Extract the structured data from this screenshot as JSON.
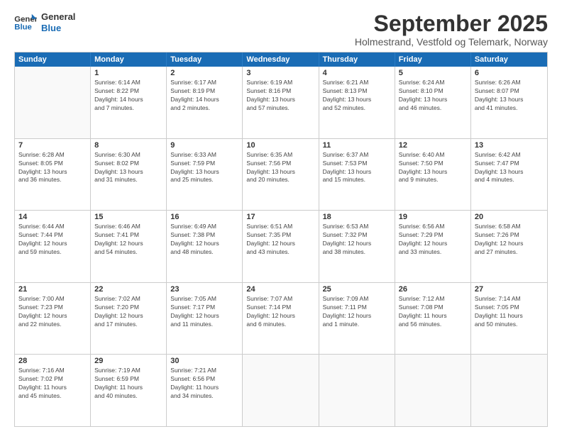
{
  "logo": {
    "line1": "General",
    "line2": "Blue"
  },
  "title": "September 2025",
  "location": "Holmestrand, Vestfold og Telemark, Norway",
  "header_days": [
    "Sunday",
    "Monday",
    "Tuesday",
    "Wednesday",
    "Thursday",
    "Friday",
    "Saturday"
  ],
  "weeks": [
    [
      {
        "day": "",
        "info": ""
      },
      {
        "day": "1",
        "info": "Sunrise: 6:14 AM\nSunset: 8:22 PM\nDaylight: 14 hours\nand 7 minutes."
      },
      {
        "day": "2",
        "info": "Sunrise: 6:17 AM\nSunset: 8:19 PM\nDaylight: 14 hours\nand 2 minutes."
      },
      {
        "day": "3",
        "info": "Sunrise: 6:19 AM\nSunset: 8:16 PM\nDaylight: 13 hours\nand 57 minutes."
      },
      {
        "day": "4",
        "info": "Sunrise: 6:21 AM\nSunset: 8:13 PM\nDaylight: 13 hours\nand 52 minutes."
      },
      {
        "day": "5",
        "info": "Sunrise: 6:24 AM\nSunset: 8:10 PM\nDaylight: 13 hours\nand 46 minutes."
      },
      {
        "day": "6",
        "info": "Sunrise: 6:26 AM\nSunset: 8:07 PM\nDaylight: 13 hours\nand 41 minutes."
      }
    ],
    [
      {
        "day": "7",
        "info": "Sunrise: 6:28 AM\nSunset: 8:05 PM\nDaylight: 13 hours\nand 36 minutes."
      },
      {
        "day": "8",
        "info": "Sunrise: 6:30 AM\nSunset: 8:02 PM\nDaylight: 13 hours\nand 31 minutes."
      },
      {
        "day": "9",
        "info": "Sunrise: 6:33 AM\nSunset: 7:59 PM\nDaylight: 13 hours\nand 25 minutes."
      },
      {
        "day": "10",
        "info": "Sunrise: 6:35 AM\nSunset: 7:56 PM\nDaylight: 13 hours\nand 20 minutes."
      },
      {
        "day": "11",
        "info": "Sunrise: 6:37 AM\nSunset: 7:53 PM\nDaylight: 13 hours\nand 15 minutes."
      },
      {
        "day": "12",
        "info": "Sunrise: 6:40 AM\nSunset: 7:50 PM\nDaylight: 13 hours\nand 9 minutes."
      },
      {
        "day": "13",
        "info": "Sunrise: 6:42 AM\nSunset: 7:47 PM\nDaylight: 13 hours\nand 4 minutes."
      }
    ],
    [
      {
        "day": "14",
        "info": "Sunrise: 6:44 AM\nSunset: 7:44 PM\nDaylight: 12 hours\nand 59 minutes."
      },
      {
        "day": "15",
        "info": "Sunrise: 6:46 AM\nSunset: 7:41 PM\nDaylight: 12 hours\nand 54 minutes."
      },
      {
        "day": "16",
        "info": "Sunrise: 6:49 AM\nSunset: 7:38 PM\nDaylight: 12 hours\nand 48 minutes."
      },
      {
        "day": "17",
        "info": "Sunrise: 6:51 AM\nSunset: 7:35 PM\nDaylight: 12 hours\nand 43 minutes."
      },
      {
        "day": "18",
        "info": "Sunrise: 6:53 AM\nSunset: 7:32 PM\nDaylight: 12 hours\nand 38 minutes."
      },
      {
        "day": "19",
        "info": "Sunrise: 6:56 AM\nSunset: 7:29 PM\nDaylight: 12 hours\nand 33 minutes."
      },
      {
        "day": "20",
        "info": "Sunrise: 6:58 AM\nSunset: 7:26 PM\nDaylight: 12 hours\nand 27 minutes."
      }
    ],
    [
      {
        "day": "21",
        "info": "Sunrise: 7:00 AM\nSunset: 7:23 PM\nDaylight: 12 hours\nand 22 minutes."
      },
      {
        "day": "22",
        "info": "Sunrise: 7:02 AM\nSunset: 7:20 PM\nDaylight: 12 hours\nand 17 minutes."
      },
      {
        "day": "23",
        "info": "Sunrise: 7:05 AM\nSunset: 7:17 PM\nDaylight: 12 hours\nand 11 minutes."
      },
      {
        "day": "24",
        "info": "Sunrise: 7:07 AM\nSunset: 7:14 PM\nDaylight: 12 hours\nand 6 minutes."
      },
      {
        "day": "25",
        "info": "Sunrise: 7:09 AM\nSunset: 7:11 PM\nDaylight: 12 hours\nand 1 minute."
      },
      {
        "day": "26",
        "info": "Sunrise: 7:12 AM\nSunset: 7:08 PM\nDaylight: 11 hours\nand 56 minutes."
      },
      {
        "day": "27",
        "info": "Sunrise: 7:14 AM\nSunset: 7:05 PM\nDaylight: 11 hours\nand 50 minutes."
      }
    ],
    [
      {
        "day": "28",
        "info": "Sunrise: 7:16 AM\nSunset: 7:02 PM\nDaylight: 11 hours\nand 45 minutes."
      },
      {
        "day": "29",
        "info": "Sunrise: 7:19 AM\nSunset: 6:59 PM\nDaylight: 11 hours\nand 40 minutes."
      },
      {
        "day": "30",
        "info": "Sunrise: 7:21 AM\nSunset: 6:56 PM\nDaylight: 11 hours\nand 34 minutes."
      },
      {
        "day": "",
        "info": ""
      },
      {
        "day": "",
        "info": ""
      },
      {
        "day": "",
        "info": ""
      },
      {
        "day": "",
        "info": ""
      }
    ]
  ]
}
